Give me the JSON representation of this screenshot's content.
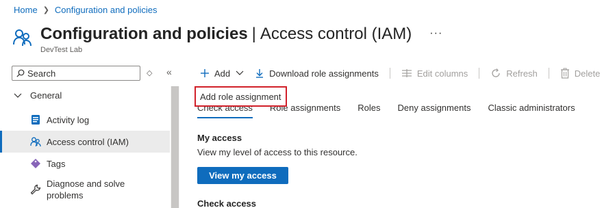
{
  "breadcrumb": [
    {
      "label": "Home"
    },
    {
      "label": "Configuration and policies"
    }
  ],
  "header": {
    "title": "Configuration and policies",
    "separator": "|",
    "section": "Access control (IAM)",
    "more": "···",
    "subtitle": "DevTest Lab",
    "icon": "users-icon"
  },
  "sidebar": {
    "search_placeholder": "Search",
    "sort_icon": "◇",
    "collapse_icon": "«",
    "group_label": "General",
    "items": [
      {
        "label": "Activity log",
        "icon": "activity-log-icon",
        "active": false
      },
      {
        "label": "Access control (IAM)",
        "icon": "users-icon",
        "active": true
      },
      {
        "label": "Tags",
        "icon": "tag-icon",
        "active": false
      },
      {
        "label": "Diagnose and solve problems",
        "icon": "wrench-icon",
        "active": false
      }
    ]
  },
  "toolbar": {
    "add": "Add",
    "download": "Download role assignments",
    "edit_columns": "Edit columns",
    "refresh": "Refresh",
    "delete": "Delete"
  },
  "dropdown": {
    "item": "Add role assignment"
  },
  "tabs": [
    {
      "label": "Check access",
      "active": true
    },
    {
      "label": "Role assignments",
      "active": false
    },
    {
      "label": "Roles",
      "active": false
    },
    {
      "label": "Deny assignments",
      "active": false
    },
    {
      "label": "Classic administrators",
      "active": false
    }
  ],
  "my_access": {
    "title": "My access",
    "description": "View my level of access to this resource.",
    "button": "View my access"
  },
  "check_access": {
    "title": "Check access"
  },
  "colors": {
    "accent": "#0f6cbd",
    "highlight_border": "#d1202a",
    "active_nav_bg": "#ebebeb"
  }
}
